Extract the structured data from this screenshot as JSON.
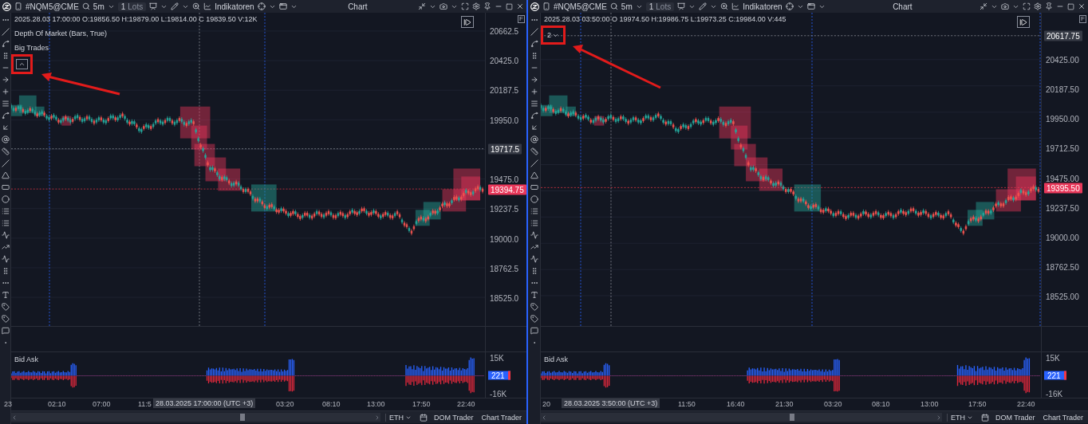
{
  "panels": [
    {
      "toolbar": {
        "symbol": "#NQM5@CME",
        "interval": "5m",
        "lots_count": "1",
        "lots_unit": "Lots",
        "indicators": "Indikatoren",
        "title": "Chart"
      },
      "ohlc": "2025.28.03 17:00:00 O:19856.50 H:19879.00 L:19814.00 C 19839.50 V:12K",
      "studies": [
        "Depth Of Market (Bars, True)",
        "Big Trades"
      ],
      "studies_toggle": {
        "kind": "collapse"
      },
      "auto_scale": "F",
      "price_ticks": [
        "20662.5",
        "20425.0",
        "20187.5",
        "19950.0",
        "19475.0",
        "19237.5",
        "19000.0",
        "18762.5",
        "18525.0"
      ],
      "crosshair": {
        "price": "19717.5",
        "time": "28.03.2025 17:00:00 (UTC +3)"
      },
      "last_price": "19394.75",
      "bid_ask": {
        "title": "Bid Ask",
        "ticks": [
          "15K",
          "-16K"
        ],
        "value": "221"
      },
      "time_ticks": [
        "23",
        "02:10",
        "07:00",
        "11:5",
        "03:20",
        "08:10",
        "13:00",
        "17:50",
        "22:40"
      ],
      "bottom": {
        "session": "ETH",
        "buttons": [
          "DOM Trader",
          "Chart Trader"
        ]
      }
    },
    {
      "toolbar": {
        "symbol": "#NQM5@CME",
        "interval": "5m",
        "lots_count": "1",
        "lots_unit": "Lots",
        "indicators": "Indikatoren",
        "title": "Chart"
      },
      "ohlc": "2025.28.03 03:50:00 O 19974.50 H:19986.75 L:19973.25 C:19984.00 V:445",
      "studies_toggle": {
        "kind": "expand",
        "count": "2"
      },
      "auto_scale": "F",
      "price_ticks": [
        "20425.00",
        "20187.50",
        "19950.00",
        "19712.50",
        "19475.00",
        "19237.50",
        "19000.00",
        "18762.50",
        "18525.00"
      ],
      "crosshair": {
        "price": "20617.75",
        "time": "28.03.2025 3:50:00 (UTC +3)"
      },
      "last_price": "19395.50",
      "bid_ask": {
        "title": "Bid Ask",
        "ticks": [
          "15K",
          "-16K"
        ],
        "value": "221"
      },
      "time_ticks": [
        "20",
        "11:50",
        "16:40",
        "21:30",
        "03:20",
        "08:10",
        "13:00",
        "17:50",
        "22:40"
      ],
      "bottom": {
        "session": "ETH",
        "buttons": [
          "DOM Trader",
          "Chart Trader"
        ]
      }
    }
  ]
}
